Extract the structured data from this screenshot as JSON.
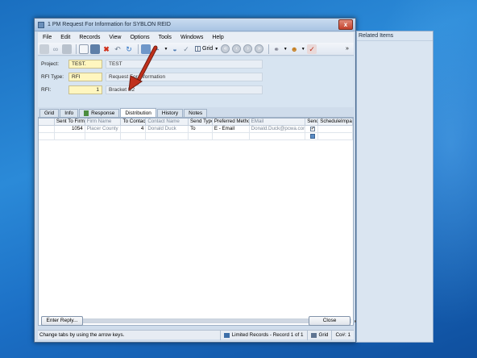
{
  "window": {
    "title": "1 PM Request For Information for SYBLON REID",
    "close_glyph": "x"
  },
  "menu": [
    "File",
    "Edit",
    "Records",
    "View",
    "Options",
    "Tools",
    "Windows",
    "Help"
  ],
  "toolbar": {
    "grid_label": "Grid",
    "expand_glyph": "»"
  },
  "fields": {
    "project": {
      "label": "Project:",
      "value": "TEST.",
      "desc": "TEST"
    },
    "rfi_type": {
      "label": "RFI Type:",
      "value": "RFI",
      "desc": "Request For Information"
    },
    "rfi": {
      "label": "RFI:",
      "value": "1",
      "desc": "Bracket U2"
    }
  },
  "tabs": [
    "Grid",
    "Info",
    "Response",
    "Distribution",
    "History",
    "Notes"
  ],
  "active_tab": "Distribution",
  "grid": {
    "columns": [
      "Sent To Firm",
      "Firm Name",
      "To Contact",
      "Contact Name",
      "Send Type",
      "Preferred Method",
      "EMail",
      "Send",
      "ScheduleImpact"
    ],
    "rows": [
      {
        "sent_to_firm": "1054",
        "firm_name": "Placer County",
        "to_contact": "4",
        "contact_name": "Donald   Duck",
        "send_type": "To",
        "preferred_method": "E - Email",
        "email": "Donald.Duck@pcwa.com",
        "send_checked": true
      }
    ]
  },
  "buttons": {
    "enter_reply": "Enter Reply...",
    "close": "Close"
  },
  "status": {
    "hint": "Change tabs by using the arrow keys.",
    "records": "Limited Records - Record 1 of 1",
    "view": "Grid",
    "co": "Co#: 1"
  },
  "related_items": {
    "title": "Related Items"
  },
  "colors": {
    "required_field": "#fff6bf",
    "arrow": "#c0301c"
  }
}
